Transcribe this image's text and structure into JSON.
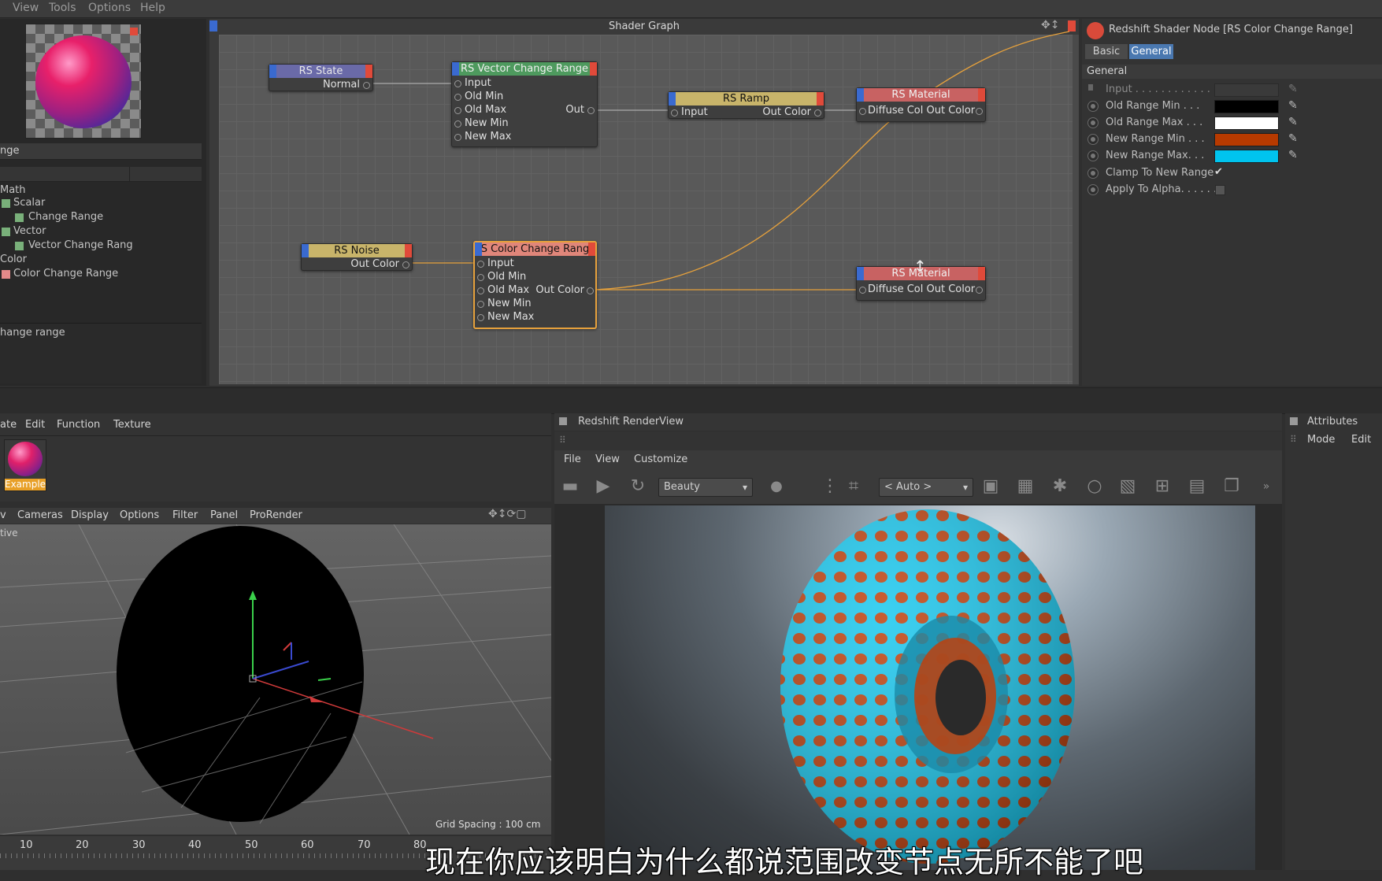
{
  "menubar": {
    "items": [
      "View",
      "Tools",
      "Options",
      "Help"
    ]
  },
  "left_panel": {
    "search_text": "nge",
    "tree": [
      {
        "label": "Math",
        "color": ""
      },
      {
        "label": "Scalar",
        "color": "#79b07a"
      },
      {
        "label": "Change Range",
        "color": "#79b07a"
      },
      {
        "label": "Vector",
        "color": "#79b07a"
      },
      {
        "label": "Vector Change Rang",
        "color": "#79b07a"
      },
      {
        "label": "Color",
        "color": ""
      },
      {
        "label": "Color Change Range",
        "color": "#e38a8a"
      }
    ],
    "description": "hange range"
  },
  "shader_graph": {
    "title": "Shader Graph",
    "nodes": {
      "state": {
        "title": "RS State",
        "ports": [
          "Normal"
        ]
      },
      "vector_change_range": {
        "title": "RS Vector Change Range",
        "ports": [
          "Input",
          "Old Min",
          "Old Max",
          "New Min",
          "New Max"
        ],
        "output": "Out"
      },
      "ramp": {
        "title": "RS Ramp",
        "input": "Input",
        "output": "Out Color"
      },
      "material1": {
        "title": "RS Material",
        "port": "Diffuse Col Out Color"
      },
      "noise": {
        "title": "RS Noise",
        "output": "Out Color"
      },
      "color_change_range": {
        "title": "S Color Change Rang",
        "ports": [
          "Input",
          "Old Min",
          "Old Max",
          "New Min",
          "New Max"
        ],
        "output": "Out Color"
      },
      "material2": {
        "title": "RS Material",
        "port": "Diffuse Col Out Color"
      }
    },
    "colors": {
      "header_blue": "#6a6aa8",
      "header_green": "#6aa06a",
      "header_yellow": "#c8b46a",
      "header_red": "#c86262",
      "wire": "#e6a13c"
    }
  },
  "attributes": {
    "title": "Redshift Shader Node [RS Color Change Range]",
    "tabs": [
      "Basic",
      "General"
    ],
    "section": "General",
    "fields": [
      {
        "label": "Input . . . . . . . . . . . .",
        "color": "#3a3a3a"
      },
      {
        "label": "Old Range Min . . .",
        "color": "#000000"
      },
      {
        "label": "Old Range Max . . .",
        "color": "#ffffff"
      },
      {
        "label": "New Range Min . . .",
        "color": "#b83a00"
      },
      {
        "label": "New Range Max. . .",
        "color": "#00c4ee"
      },
      {
        "label": "Clamp To New Range",
        "check": "✔"
      },
      {
        "label": "Apply To Alpha. . . . . .",
        "check": ""
      }
    ]
  },
  "material_manager": {
    "menu": [
      "ate",
      "Edit",
      "Function",
      "Texture"
    ],
    "material_name": "Example"
  },
  "viewport": {
    "menu": [
      "v",
      "Cameras",
      "Display",
      "Options",
      "Filter",
      "Panel",
      "ProRender"
    ],
    "label": "tive",
    "grid_spacing": "Grid Spacing : 100 cm",
    "timeline_ticks": [
      "10",
      "20",
      "30",
      "40",
      "50",
      "60",
      "70",
      "80"
    ]
  },
  "renderview": {
    "title": "Redshift RenderView",
    "menu": [
      "File",
      "View",
      "Customize"
    ],
    "aov": "Beauty",
    "zoom": "< Auto >",
    "colors": {
      "cyan": "#18c8ef",
      "orange": "#c0400c"
    }
  },
  "attributes_mini": {
    "title": "Attributes",
    "menu": [
      "Mode",
      "Edit"
    ]
  },
  "subtitle": "现在你应该明白为什么都说范围改变节点无所不能了吧"
}
